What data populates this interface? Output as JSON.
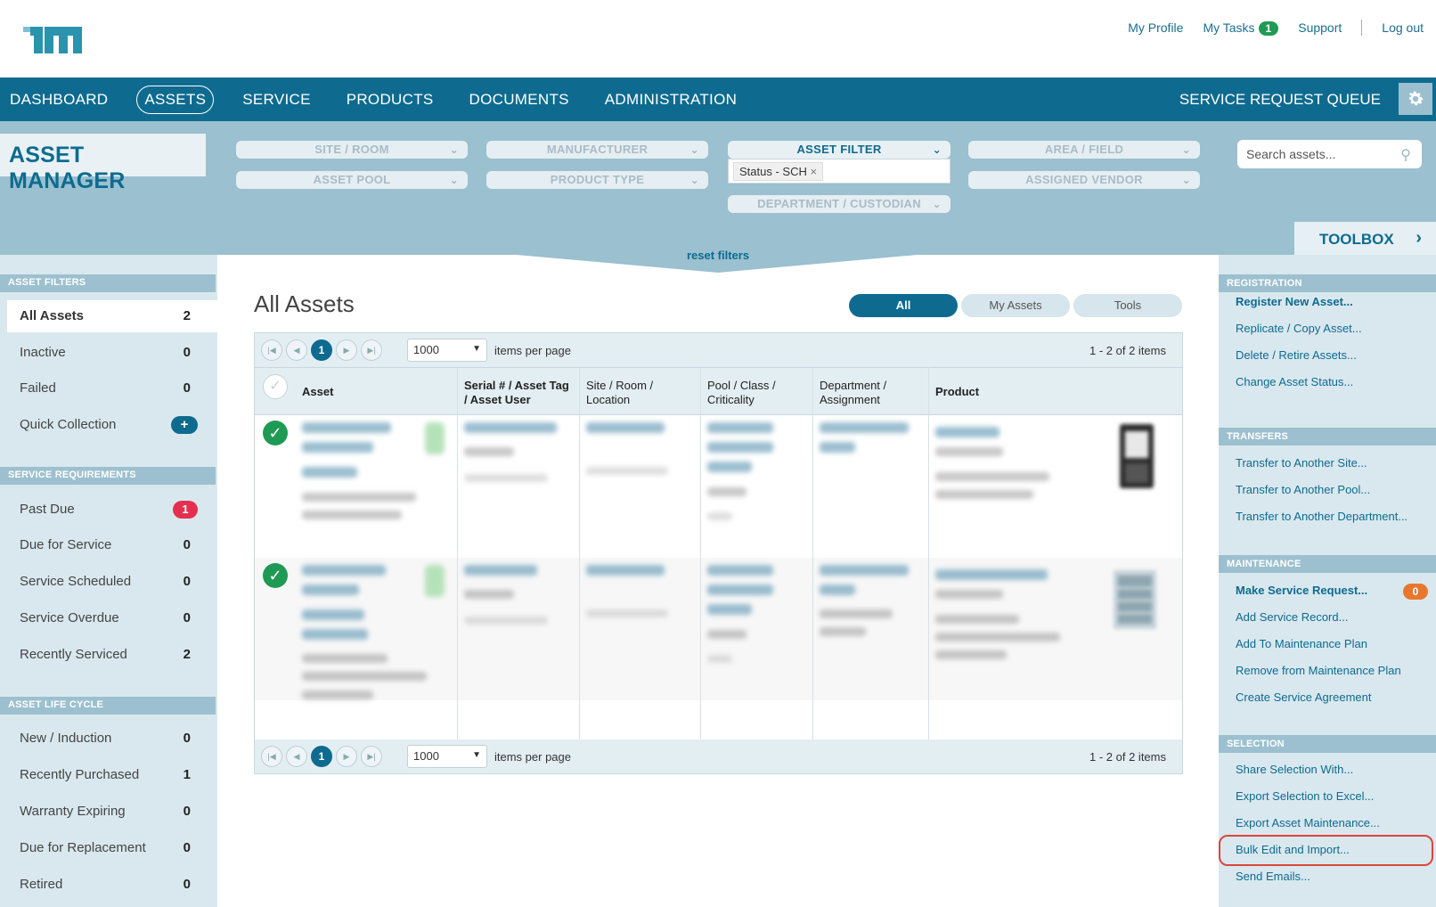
{
  "topbar": {
    "my_profile": "My Profile",
    "my_tasks": "My Tasks",
    "my_tasks_count": "1",
    "support": "Support",
    "log_out": "Log out"
  },
  "nav": {
    "items": [
      "DASHBOARD",
      "ASSETS",
      "SERVICE",
      "PRODUCTS",
      "DOCUMENTS",
      "ADMINISTRATION"
    ],
    "active": "ASSETS",
    "service_request_queue": "SERVICE REQUEST QUEUE"
  },
  "filters": {
    "title": "ASSET MANAGER",
    "site_room": "SITE / ROOM",
    "manufacturer": "MANUFACTURER",
    "asset_filter": "ASSET FILTER",
    "area_field": "AREA / FIELD",
    "asset_pool": "ASSET POOL",
    "product_type": "PRODUCT TYPE",
    "department_custodian": "DEPARTMENT / CUSTODIAN",
    "assigned_vendor": "ASSIGNED VENDOR",
    "status_chip": "Status - SCH",
    "search_placeholder": "Search assets...",
    "reset": "reset filters",
    "toolbox": "TOOLBOX"
  },
  "left": {
    "asset_filters_head": "ASSET FILTERS",
    "asset_filters": [
      {
        "label": "All Assets",
        "count": "2"
      },
      {
        "label": "Inactive",
        "count": "0"
      },
      {
        "label": "Failed",
        "count": "0"
      },
      {
        "label": "Quick Collection",
        "count": "+"
      }
    ],
    "service_head": "SERVICE REQUIREMENTS",
    "service": [
      {
        "label": "Past Due",
        "count": "1"
      },
      {
        "label": "Due for Service",
        "count": "0"
      },
      {
        "label": "Service Scheduled",
        "count": "0"
      },
      {
        "label": "Service Overdue",
        "count": "0"
      },
      {
        "label": "Recently Serviced",
        "count": "2"
      }
    ],
    "lifecycle_head": "ASSET LIFE CYCLE",
    "lifecycle": [
      {
        "label": "New / Induction",
        "count": "0"
      },
      {
        "label": "Recently Purchased",
        "count": "1"
      },
      {
        "label": "Warranty Expiring",
        "count": "0"
      },
      {
        "label": "Due for Replacement",
        "count": "0"
      },
      {
        "label": "Retired",
        "count": "0"
      }
    ]
  },
  "main": {
    "title": "All Assets",
    "tabs": [
      "All",
      "My Assets",
      "Tools"
    ],
    "pager": {
      "current_page": "1",
      "per_page": "1000",
      "items_per_page": "items per page",
      "range": "1 - 2 of 2 items"
    },
    "columns": {
      "asset": "Asset",
      "serial_1": "Serial # / Asset Tag",
      "serial_2": "/ Asset User",
      "site_1": "Site / Room /",
      "site_2": "Location",
      "pool_1": "Pool / Class /",
      "pool_2": "Criticality",
      "dept_1": "Department /",
      "dept_2": "Assignment",
      "product": "Product"
    }
  },
  "right": {
    "registration_head": "REGISTRATION",
    "registration": [
      "Register New Asset...",
      "Replicate / Copy Asset...",
      "Delete / Retire Assets...",
      "Change Asset Status..."
    ],
    "transfers_head": "TRANSFERS",
    "transfers": [
      "Transfer to Another Site...",
      "Transfer to Another Pool...",
      "Transfer to Another Department..."
    ],
    "maintenance_head": "MAINTENANCE",
    "maintenance": [
      "Make Service Request...",
      "Add Service Record...",
      "Add To Maintenance Plan",
      "Remove from Maintenance Plan",
      "Create Service Agreement"
    ],
    "service_request_count": "0",
    "selection_head": "SELECTION",
    "selection": [
      "Share Selection With...",
      "Export Selection to Excel...",
      "Export Asset Maintenance...",
      "Bulk Edit and Import...",
      "Send Emails..."
    ]
  },
  "colors": {
    "primary": "#0e6b8f",
    "filter_band": "#9bc0cf",
    "sidebar": "#d9e8ef",
    "success": "#1f9a55",
    "danger": "#e4304e",
    "warning": "#e8772e",
    "highlight": "#d9473b"
  }
}
